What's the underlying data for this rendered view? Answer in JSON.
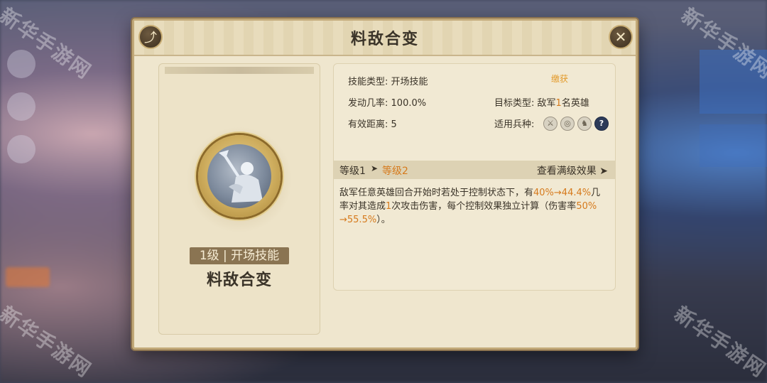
{
  "watermark": "新华手游网",
  "dialog": {
    "title": "料敌合变",
    "share_icon": "share-icon",
    "close_icon": "close-icon",
    "close_glyph": "✕",
    "share_glyph": "⤴"
  },
  "skill": {
    "level_badge": "1级 | 开场技能",
    "name": "料敌合变"
  },
  "details": {
    "tag": "缴获",
    "skill_type_label": "技能类型:",
    "skill_type": "开场技能",
    "trigger_rate_label": "发动几率:",
    "trigger_rate": "100.0%",
    "range_label": "有效距离:",
    "range": "5",
    "target_label": "目标类型:",
    "target_pre": "敌军",
    "target_num": "1",
    "target_post": "名英雄",
    "troops_label": "适用兵种:",
    "troop_icons": [
      "spear-icon",
      "bow-icon",
      "horse-icon",
      "question-icon"
    ],
    "troop_glyphs": [
      "⚔",
      "◎",
      "♞",
      "?"
    ]
  },
  "levels": {
    "level1": "等级1",
    "arrow": "➤",
    "level2": "等级2",
    "view_full": "查看满级效果 ➤"
  },
  "description": {
    "part1": "敌军任意英雄回合开始时若处于控制状态下，有",
    "rate": "40%→44.4%",
    "part2": "几率对其造成",
    "hits": "1",
    "part3": "次攻击伤害，每个控制效果独立计算（伤害率",
    "dmg": "50% →55.5%",
    "part4": "）。"
  },
  "colors": {
    "highlight": "#d67a1c",
    "panel": "#efe6ce",
    "border": "#c2a978"
  }
}
